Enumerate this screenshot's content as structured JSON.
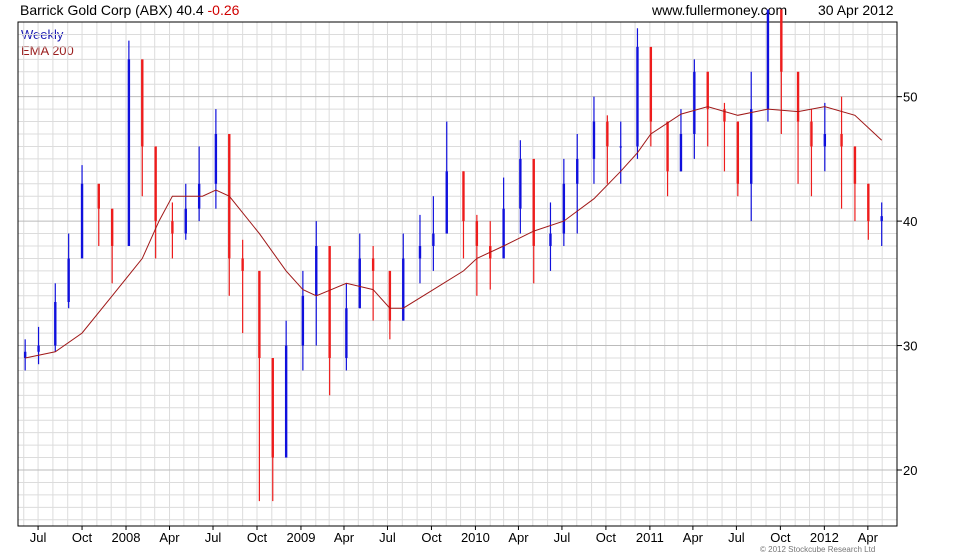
{
  "header": {
    "symbol_text": "Barrick Gold Corp (ABX) 40.4",
    "change": "-0.26",
    "site": "www.fullermoney.com",
    "date": "30 Apr 2012"
  },
  "legend": {
    "series1": "Weekly",
    "series2": "EMA 200"
  },
  "copyright": "© 2012 Stockcube Research Ltd",
  "colors": {
    "up": "#1010dd",
    "down": "#ee1c1c",
    "ema": "#a01818",
    "grid": "#dcdcdc",
    "hline": "#bbbbbb"
  },
  "chart_data": {
    "type": "line",
    "title": "Barrick Gold Corp (ABX) 40.4 -0.26",
    "xlabel": "",
    "ylabel": "",
    "ylim": [
      15.5,
      56
    ],
    "yticks": [
      20,
      30,
      40,
      50
    ],
    "xticks": [
      "Jul",
      "Oct",
      "2008",
      "Apr",
      "Jul",
      "Oct",
      "2009",
      "Apr",
      "Jul",
      "Oct",
      "2010",
      "Apr",
      "Jul",
      "Oct",
      "2011",
      "Apr",
      "Jul",
      "Oct",
      "2012",
      "Apr"
    ],
    "xtick_months": [
      "2007-07",
      "2007-10",
      "2008-01",
      "2008-04",
      "2008-07",
      "2008-10",
      "2009-01",
      "2009-04",
      "2009-07",
      "2009-10",
      "2010-01",
      "2010-04",
      "2010-07",
      "2010-10",
      "2011-01",
      "2011-04",
      "2011-07",
      "2011-10",
      "2012-01",
      "2012-04"
    ],
    "grid": true,
    "legend_position": "top-left",
    "series": [
      {
        "name": "Weekly",
        "style": "candles",
        "x": [
          "2007-06-04",
          "2007-07-02",
          "2007-08-06",
          "2007-09-03",
          "2007-10-01",
          "2007-11-05",
          "2007-12-03",
          "2008-01-07",
          "2008-02-04",
          "2008-03-03",
          "2008-04-07",
          "2008-05-05",
          "2008-06-02",
          "2008-07-07",
          "2008-08-04",
          "2008-09-01",
          "2008-10-06",
          "2008-11-03",
          "2008-12-01",
          "2009-01-05",
          "2009-02-02",
          "2009-03-02",
          "2009-04-06",
          "2009-05-04",
          "2009-06-01",
          "2009-07-06",
          "2009-08-03",
          "2009-09-07",
          "2009-10-05",
          "2009-11-02",
          "2009-12-07",
          "2010-01-04",
          "2010-02-01",
          "2010-03-01",
          "2010-04-05",
          "2010-05-03",
          "2010-06-07",
          "2010-07-05",
          "2010-08-02",
          "2010-09-06",
          "2010-10-04",
          "2010-11-01",
          "2010-12-06",
          "2011-01-03",
          "2011-02-07",
          "2011-03-07",
          "2011-04-04",
          "2011-05-02",
          "2011-06-06",
          "2011-07-04",
          "2011-08-01",
          "2011-09-05",
          "2011-10-03",
          "2011-11-07",
          "2011-12-05",
          "2012-01-02",
          "2012-02-06",
          "2012-03-05",
          "2012-04-02",
          "2012-04-30"
        ],
        "close": [
          29.5,
          30,
          33.5,
          37,
          43,
          41,
          38,
          53,
          46,
          40,
          39,
          41,
          43,
          47,
          37,
          36,
          29,
          21,
          30,
          34,
          38,
          29,
          33,
          37,
          36,
          32,
          37,
          38,
          39,
          44,
          40,
          38,
          37,
          41,
          45,
          38,
          39,
          43,
          45,
          48,
          46,
          46,
          54,
          48,
          44,
          47,
          52,
          49,
          48,
          43,
          49,
          57,
          52,
          48,
          46,
          47,
          46,
          43,
          40,
          40.4
        ],
        "high": [
          30.5,
          31.5,
          35,
          39,
          44.5,
          42.5,
          40,
          54.5,
          50,
          44,
          41.5,
          43,
          46,
          49,
          41,
          38.5,
          33,
          25,
          32,
          36,
          40,
          33,
          35,
          39,
          38,
          34.5,
          39,
          40.5,
          42,
          48,
          44,
          40.5,
          40,
          43.5,
          46.5,
          41,
          41.5,
          45,
          47,
          50,
          48.5,
          48,
          55.5,
          52.5,
          46,
          49,
          53,
          52,
          49.5,
          46,
          52,
          57,
          55,
          51,
          49,
          49.5,
          50,
          46,
          43,
          41.5
        ],
        "low": [
          28,
          28.5,
          29.5,
          33,
          40,
          38,
          35,
          43,
          42,
          37,
          37,
          38.5,
          40,
          41,
          34,
          31,
          17.5,
          17.5,
          22,
          28,
          30,
          26,
          28,
          33,
          32,
          30.5,
          33,
          35,
          36,
          39,
          37,
          34,
          34.5,
          38,
          39,
          35,
          36,
          38,
          39,
          43,
          43,
          43,
          45,
          46,
          42,
          44,
          45,
          46,
          44,
          42,
          40,
          48,
          47,
          43,
          42,
          44,
          41,
          40,
          38.5,
          38
        ]
      },
      {
        "name": "EMA 200",
        "style": "line",
        "x": [
          "2007-06-04",
          "2007-08-06",
          "2007-10-01",
          "2007-12-03",
          "2008-02-04",
          "2008-03-10",
          "2008-04-07",
          "2008-06-09",
          "2008-07-07",
          "2008-08-04",
          "2008-10-06",
          "2008-12-01",
          "2009-01-05",
          "2009-02-02",
          "2009-04-06",
          "2009-06-01",
          "2009-07-06",
          "2009-08-03",
          "2009-10-05",
          "2009-12-07",
          "2010-01-04",
          "2010-03-01",
          "2010-05-03",
          "2010-07-05",
          "2010-09-06",
          "2010-11-01",
          "2010-12-06",
          "2011-01-03",
          "2011-03-07",
          "2011-05-02",
          "2011-07-04",
          "2011-09-05",
          "2011-11-07",
          "2012-01-02",
          "2012-03-05",
          "2012-04-30"
        ],
        "y": [
          29,
          29.5,
          31,
          34,
          37,
          40,
          42,
          42,
          42.5,
          42,
          39,
          36,
          34.5,
          34,
          35,
          34.5,
          33,
          33,
          34.5,
          36,
          37,
          38,
          39.2,
          40,
          41.8,
          44,
          45.5,
          47,
          48.6,
          49.2,
          48.5,
          49,
          48.8,
          49.2,
          48.5,
          46.5
        ]
      }
    ]
  }
}
